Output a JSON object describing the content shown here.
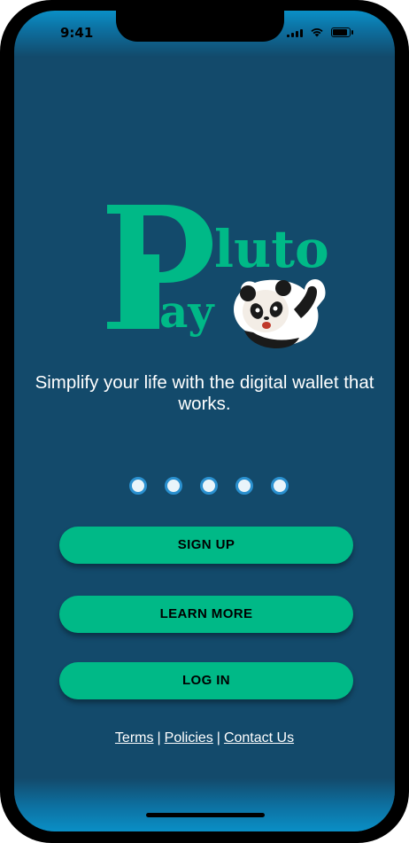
{
  "status_bar": {
    "time": "9:41"
  },
  "logo": {
    "wordmark_top": "luto",
    "wordmark_bottom": "ay",
    "big_letters": "P",
    "mascot": "panda-waving-icon",
    "brand_color": "#00b987"
  },
  "tagline": "Simplify your life with the digital wallet that works.",
  "pager": {
    "count": 5
  },
  "buttons": {
    "signup": "SIGN UP",
    "learn_more": "LEARN MORE",
    "login": "LOG IN"
  },
  "footer": {
    "terms": "Terms",
    "policies": "Policies",
    "contact": "Contact Us",
    "separator": "|"
  },
  "colors": {
    "background": "#134a6b",
    "accent": "#00b987",
    "dot_border": "#2a90cf"
  }
}
